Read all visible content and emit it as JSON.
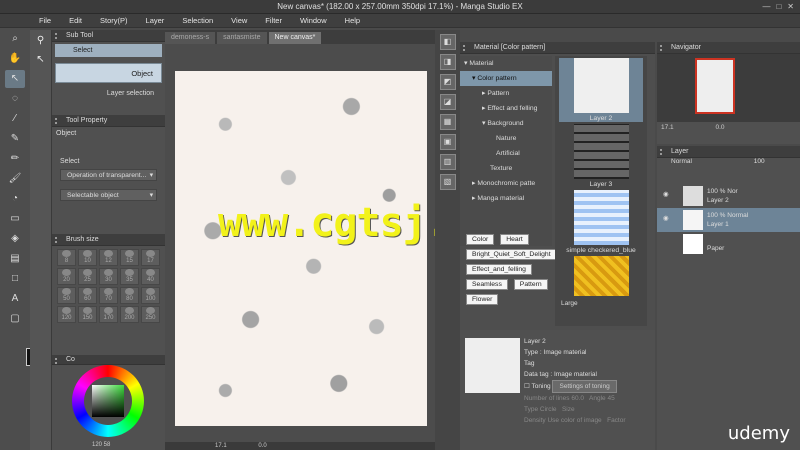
{
  "window": {
    "title": "New canvas* (182.00 x 257.00mm 350dpi 17.1%) - Manga Studio EX"
  },
  "menu": [
    "File",
    "Edit",
    "Story(P)",
    "Layer",
    "Selection",
    "View",
    "Filter",
    "Window",
    "Help"
  ],
  "left_panel": {
    "subtool_title": "Sub Tool",
    "select_label": "Select",
    "object_label": "Object",
    "layer_selection_label": "Layer selection",
    "tool_property_title": "Tool Property",
    "tool_property_object": "Object",
    "select_heading": "Select",
    "operation_dropdown": "Operation of transparent...",
    "selectable_dropdown": "Selectable object",
    "brush_size_title": "Brush size",
    "brush_sizes": [
      "8",
      "10",
      "12",
      "15",
      "17",
      "20",
      "25",
      "30",
      "35",
      "40",
      "50",
      "60",
      "70",
      "80",
      "100",
      "120",
      "150",
      "170",
      "200",
      "250"
    ],
    "color_title": "Co",
    "color_bottom": "120 58"
  },
  "canvas": {
    "tabs": [
      "demoness-s",
      "santasmiste",
      "New canvas*"
    ],
    "zoom": "17.1",
    "rotation": "0.0"
  },
  "watermark": "www.cgtsj.com",
  "material": {
    "title": "Material [Color pattern]",
    "tree": [
      {
        "label": "Material",
        "indent": 0,
        "selected": false
      },
      {
        "label": "Color pattern",
        "indent": 1,
        "selected": true
      },
      {
        "label": "Pattern",
        "indent": 2,
        "selected": false
      },
      {
        "label": "Effect and felling",
        "indent": 2,
        "selected": false
      },
      {
        "label": "Background",
        "indent": 2,
        "selected": false
      },
      {
        "label": "Nature",
        "indent": 3,
        "selected": false
      },
      {
        "label": "Artificial",
        "indent": 3,
        "selected": false
      },
      {
        "label": "Texture",
        "indent": 2,
        "selected": false
      },
      {
        "label": "Monochromic patte",
        "indent": 1,
        "selected": false
      },
      {
        "label": "Manga material",
        "indent": 1,
        "selected": false
      }
    ],
    "thumbs": [
      "Layer 2",
      "Layer 3",
      "simple checkered_blue",
      ""
    ],
    "tags": [
      "Color",
      "Heart",
      "Bright_Quiet_Soft_Delight",
      "Effect_and_felling",
      "Seamless",
      "Pattern",
      "Flower"
    ],
    "size_label": "Large",
    "detail": {
      "name": "Layer 2",
      "type": "Type : Image material",
      "tag": "Tag",
      "data_tag": "Data tag : Image material",
      "toning": "Toning",
      "settings_toning": "Settings of toning",
      "lines": "Number of lines  60.0",
      "angle": "Angle  45",
      "type2": "Type  Circle",
      "size": "Size",
      "density": "Density  Use color of image",
      "factor": "Factor"
    }
  },
  "navigator": {
    "title": "Navigator",
    "zoom": "17.1",
    "angle": "0.0"
  },
  "layers": {
    "title": "Layer",
    "blend": "Normal",
    "opacity": "100",
    "rows": [
      {
        "opacity": "100 %",
        "mode": "Nor",
        "name": "Layer 2",
        "selected": false
      },
      {
        "opacity": "100 %",
        "mode": "Normal",
        "name": "Layer 1",
        "selected": true
      },
      {
        "opacity": "",
        "mode": "",
        "name": "Paper",
        "selected": false
      }
    ]
  },
  "brand": "udemy",
  "colors": {
    "fg": "#111111",
    "bg": "#e879d6",
    "selection": "#7e97aa",
    "watermark": "#f2f21a"
  }
}
